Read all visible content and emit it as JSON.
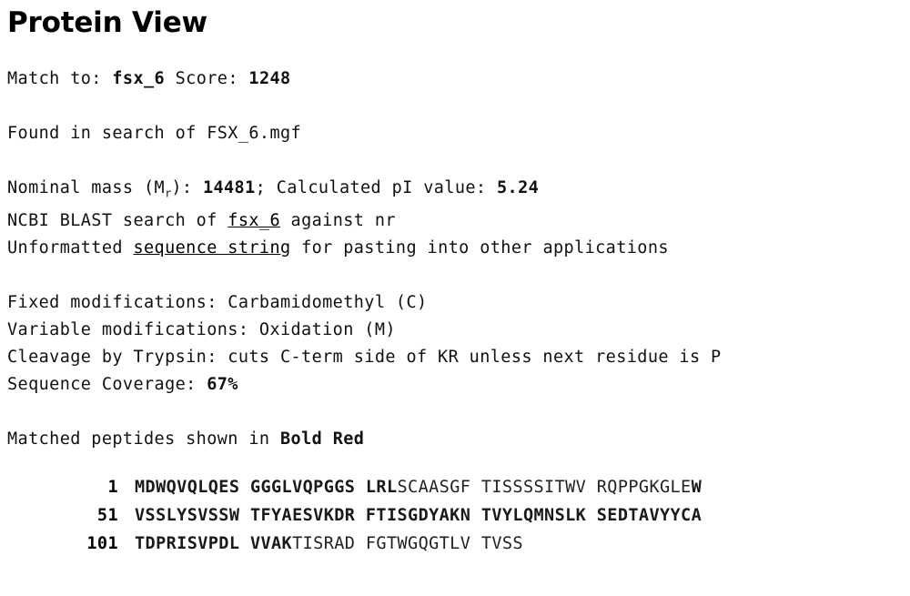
{
  "title": "Protein View",
  "match": {
    "label": "Match to: ",
    "name": "fsx_6",
    "score_label": " Score: ",
    "score": "1248"
  },
  "found": {
    "text": "Found in search of FSX_6.mgf"
  },
  "mass": {
    "prefix": "Nominal mass (M",
    "subscript": "r",
    "suffix": "): ",
    "value": "14481",
    "pi_label": "; Calculated pI value: ",
    "pi_value": "5.24"
  },
  "blast": {
    "prefix": "NCBI BLAST search of ",
    "link": "fsx_6",
    "suffix": " against nr"
  },
  "unformatted": {
    "prefix": "Unformatted ",
    "link": "sequence string",
    "suffix": " for pasting into other applications"
  },
  "modifications": {
    "fixed": "Fixed modifications: Carbamidomethyl (C)",
    "variable": "Variable modifications: Oxidation (M)",
    "cleavage": "Cleavage by Trypsin: cuts C-term side of KR unless next residue is P",
    "coverage_label": "Sequence Coverage: ",
    "coverage_value": "67%"
  },
  "legend": {
    "prefix": "Matched peptides shown in ",
    "emphasis": "Bold Red"
  },
  "sequence": {
    "rows": [
      {
        "number": "1",
        "chunks": [
          [
            {
              "t": "MDWQVQLQES",
              "m": true
            }
          ],
          [
            {
              "t": "GGGLVQPGGS",
              "m": true
            }
          ],
          [
            {
              "t": "LRL",
              "m": true
            },
            {
              "t": "SCAASGF",
              "m": false
            }
          ],
          [
            {
              "t": "TISSSSITWV",
              "m": false
            }
          ],
          [
            {
              "t": "RQPPGKGLE",
              "m": false
            },
            {
              "t": "W",
              "m": true
            }
          ]
        ]
      },
      {
        "number": "51",
        "chunks": [
          [
            {
              "t": "VSSLYSVSSW",
              "m": true
            }
          ],
          [
            {
              "t": "TFYAESVKDR",
              "m": true
            }
          ],
          [
            {
              "t": "FTISGDYAKN",
              "m": true
            }
          ],
          [
            {
              "t": "TVYLQMNSLK",
              "m": true
            }
          ],
          [
            {
              "t": "SEDTAVYYCA",
              "m": true
            }
          ]
        ]
      },
      {
        "number": "101",
        "chunks": [
          [
            {
              "t": "TDPRISVPDL",
              "m": true
            }
          ],
          [
            {
              "t": "VVAK",
              "m": true
            },
            {
              "t": "TISRAD",
              "m": false
            }
          ],
          [
            {
              "t": "FGTWGQGTLV",
              "m": false
            }
          ],
          [
            {
              "t": "TVSS",
              "m": false
            }
          ]
        ]
      }
    ]
  }
}
